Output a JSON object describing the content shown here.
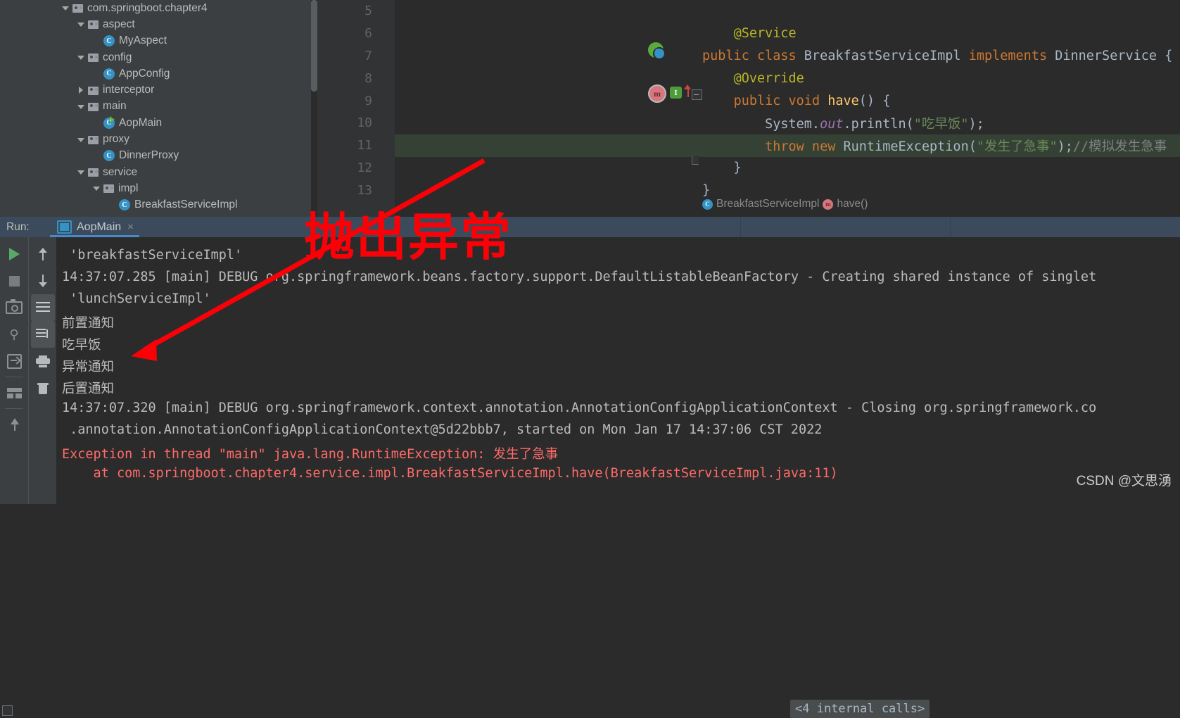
{
  "project_tree": {
    "items": [
      {
        "label": "com.springboot.chapter4",
        "indent": 0,
        "arrow": "down",
        "icon": "folder-icon"
      },
      {
        "label": "aspect",
        "indent": 1,
        "arrow": "down",
        "icon": "folder-icon"
      },
      {
        "label": "MyAspect",
        "indent": 2,
        "arrow": "none",
        "icon": "class-icon"
      },
      {
        "label": "config",
        "indent": 1,
        "arrow": "down",
        "icon": "folder-icon"
      },
      {
        "label": "AppConfig",
        "indent": 2,
        "arrow": "none",
        "icon": "class-icon"
      },
      {
        "label": "interceptor",
        "indent": 1,
        "arrow": "right",
        "icon": "folder-icon"
      },
      {
        "label": "main",
        "indent": 1,
        "arrow": "down",
        "icon": "folder-icon"
      },
      {
        "label": "AopMain",
        "indent": 2,
        "arrow": "none",
        "icon": "class-runnable-icon"
      },
      {
        "label": "proxy",
        "indent": 1,
        "arrow": "down",
        "icon": "folder-icon"
      },
      {
        "label": "DinnerProxy",
        "indent": 2,
        "arrow": "none",
        "icon": "class-icon"
      },
      {
        "label": "service",
        "indent": 1,
        "arrow": "down",
        "icon": "folder-icon"
      },
      {
        "label": "impl",
        "indent": 2,
        "arrow": "down",
        "icon": "folder-icon"
      },
      {
        "label": "BreakfastServiceImpl",
        "indent": 3,
        "arrow": "none",
        "icon": "class-icon"
      }
    ]
  },
  "editor": {
    "lines": [
      {
        "number": "5",
        "segments": []
      },
      {
        "number": "6",
        "segments": [
          {
            "t": "    ",
            "c": "plain"
          },
          {
            "t": "@Service",
            "c": "an"
          }
        ]
      },
      {
        "number": "7",
        "segments": [
          {
            "t": "",
            "c": "plain"
          },
          {
            "t": "public class ",
            "c": "k"
          },
          {
            "t": "BreakfastServiceImpl ",
            "c": "cls"
          },
          {
            "t": "implements ",
            "c": "k"
          },
          {
            "t": "DinnerService {",
            "c": "cls"
          }
        ]
      },
      {
        "number": "8",
        "segments": [
          {
            "t": "    ",
            "c": "plain"
          },
          {
            "t": "@Override",
            "c": "an"
          }
        ]
      },
      {
        "number": "9",
        "segments": [
          {
            "t": "    ",
            "c": "plain"
          },
          {
            "t": "public void ",
            "c": "k"
          },
          {
            "t": "have",
            "c": "fn"
          },
          {
            "t": "() {",
            "c": "brc"
          }
        ]
      },
      {
        "number": "10",
        "segments": [
          {
            "t": "        System.",
            "c": "plain"
          },
          {
            "t": "out",
            "c": "st"
          },
          {
            "t": ".println(",
            "c": "plain"
          },
          {
            "t": "\"吃早饭\"",
            "c": "str"
          },
          {
            "t": ");",
            "c": "plain"
          }
        ]
      },
      {
        "number": "11",
        "segments": [
          {
            "t": "        ",
            "c": "plain"
          },
          {
            "t": "throw new ",
            "c": "k"
          },
          {
            "t": "RuntimeException(",
            "c": "cls"
          },
          {
            "t": "\"发生了急事\"",
            "c": "str"
          },
          {
            "t": ");",
            "c": "plain"
          },
          {
            "t": "//模拟发生急事",
            "c": "cm"
          }
        ],
        "highlight": true
      },
      {
        "number": "12",
        "segments": [
          {
            "t": "    }",
            "c": "brc"
          }
        ]
      },
      {
        "number": "13",
        "segments": [
          {
            "t": "}",
            "c": "brc"
          }
        ]
      }
    ],
    "breadcrumb": {
      "class_name": "BreakfastServiceImpl",
      "method_name": "have()"
    }
  },
  "run_panel": {
    "label": "Run:",
    "tab": {
      "name": "AopMain",
      "close": "×",
      "icon": "run-configuration-icon"
    },
    "toolbar_left": [
      {
        "name": "rerun-button",
        "icon": "play-icon"
      },
      {
        "name": "stop-button",
        "icon": "stop-icon"
      },
      {
        "name": "screenshot-button",
        "icon": "camera-icon"
      },
      {
        "name": "filter-button",
        "icon": "bug-filter-icon"
      },
      {
        "name": "export-button",
        "icon": "export-icon"
      },
      {
        "name": "layout-button",
        "icon": "layout-icon"
      },
      {
        "name": "pin-button",
        "icon": "pin-icon"
      }
    ],
    "toolbar_right": [
      {
        "name": "up-button",
        "icon": "arrow-up-icon"
      },
      {
        "name": "down-button",
        "icon": "arrow-down-icon"
      },
      {
        "name": "soft-wrap-button",
        "icon": "soft-wrap-icon",
        "active": true
      },
      {
        "name": "scroll-to-end-button",
        "icon": "scroll-to-end-icon",
        "active": true
      },
      {
        "name": "print-button",
        "icon": "print-icon"
      },
      {
        "name": "clear-all-button",
        "icon": "trash-icon"
      }
    ],
    "console_lines": [
      {
        "text": " 'breakfastServiceImpl'",
        "error": false
      },
      {
        "text": "14:37:07.285 [main] DEBUG org.springframework.beans.factory.support.DefaultListableBeanFactory - Creating shared instance of singlet",
        "error": false
      },
      {
        "text": " 'lunchServiceImpl'",
        "error": false
      },
      {
        "text": "前置通知",
        "error": false
      },
      {
        "text": "吃早饭",
        "error": false
      },
      {
        "text": "异常通知",
        "error": false
      },
      {
        "text": "后置通知",
        "error": false
      },
      {
        "text": "14:37:07.320 [main] DEBUG org.springframework.context.annotation.AnnotationConfigApplicationContext - Closing org.springframework.co",
        "error": false
      },
      {
        "text": " .annotation.AnnotationConfigApplicationContext@5d22bbb7, started on Mon Jan 17 14:37:06 CST 2022",
        "error": false
      },
      {
        "text": "Exception in thread \"main\" java.lang.RuntimeException: 发生了急事",
        "error": true
      },
      {
        "text": "    at com.springboot.chapter4.service.impl.BreakfastServiceImpl.have(BreakfastServiceImpl.java:11)",
        "error": true
      }
    ],
    "internal_calls": "<4 internal calls>"
  },
  "annotations": {
    "callout_text": "抛出异常",
    "callout_color": "#fb0007"
  },
  "watermark": "CSDN @文思湧"
}
